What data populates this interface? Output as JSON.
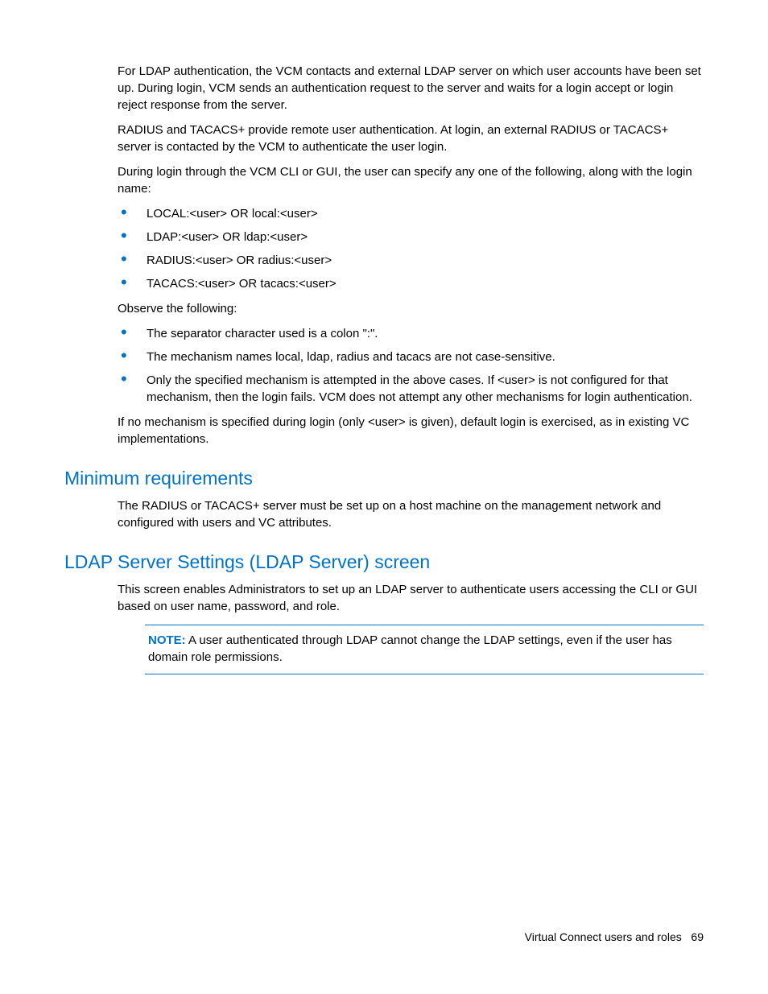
{
  "para1": "For LDAP authentication, the VCM contacts and external LDAP server on which user accounts have been set up. During login, VCM sends an authentication request to the server and waits for a login accept or login reject response from the server.",
  "para2": "RADIUS and TACACS+ provide remote user authentication. At login, an external RADIUS or TACACS+ server is contacted by the VCM to authenticate the user login.",
  "para3": "During login through the VCM CLI or GUI, the user can specify any one of the following, along with the login name:",
  "list1": [
    "LOCAL:<user> OR local:<user>",
    "LDAP:<user> OR ldap:<user>",
    "RADIUS:<user> OR radius:<user>",
    "TACACS:<user> OR tacacs:<user>"
  ],
  "para4": "Observe the following:",
  "list2": [
    "The separator character used is a colon \":\".",
    "The mechanism names local, ldap, radius and tacacs are not case-sensitive.",
    "Only the specified mechanism is attempted in the above cases. If <user> is not configured for that mechanism, then the login fails. VCM does not attempt any other mechanisms for login authentication."
  ],
  "para5": "If no mechanism is specified during login (only <user> is given), default login is exercised, as in existing VC implementations.",
  "heading1": "Minimum requirements",
  "para6": "The RADIUS or TACACS+ server must be set up on a host machine on the management network and configured with users and VC attributes.",
  "heading2": "LDAP Server Settings (LDAP Server) screen",
  "para7": "This screen enables Administrators to set up an LDAP server to authenticate users accessing the CLI or GUI based on user name, password, and role.",
  "note_label": "NOTE:",
  "note_text": "  A user authenticated through LDAP cannot change the LDAP settings, even if the user has domain role permissions.",
  "footer_text": "Virtual Connect users and roles",
  "footer_page": "69"
}
